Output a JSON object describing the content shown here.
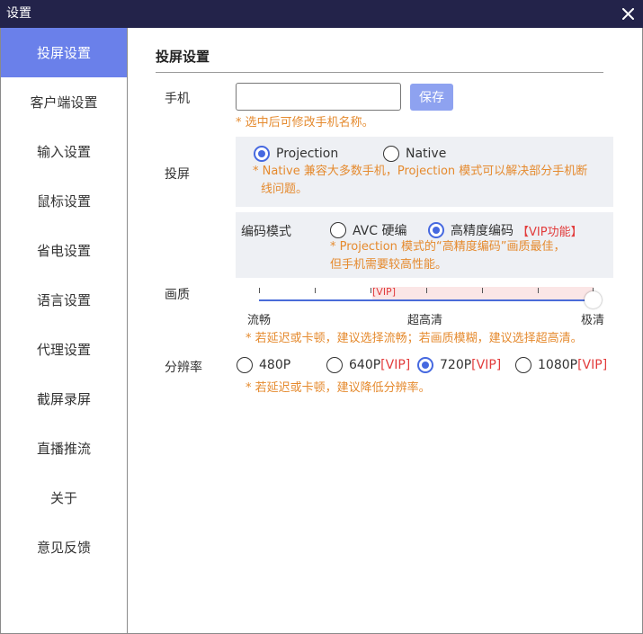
{
  "window": {
    "title": "设置"
  },
  "sidebar": {
    "items": [
      {
        "label": "投屏设置",
        "active": true
      },
      {
        "label": "客户端设置"
      },
      {
        "label": "输入设置"
      },
      {
        "label": "鼠标设置"
      },
      {
        "label": "省电设置"
      },
      {
        "label": "语言设置"
      },
      {
        "label": "代理设置"
      },
      {
        "label": "截屏录屏"
      },
      {
        "label": "直播推流"
      },
      {
        "label": "关于"
      },
      {
        "label": "意见反馈"
      }
    ]
  },
  "main": {
    "title": "投屏设置",
    "phone": {
      "label": "手机",
      "value": "",
      "save_label": "保存",
      "note": "* 选中后可修改手机名称。"
    },
    "projection": {
      "label": "投屏",
      "options": [
        {
          "label": "Projection",
          "selected": true
        },
        {
          "label": "Native",
          "selected": false
        }
      ],
      "note_line1": "* Native 兼容大多数手机，Projection 模式可以解决部分手机断",
      "note_line2": "线问题。"
    },
    "encoding": {
      "label": "编码模式",
      "options": [
        {
          "label": "AVC 硬编",
          "selected": false
        },
        {
          "label": "高精度编码",
          "selected": true,
          "tag": "【VIP功能】"
        }
      ],
      "note_line1": "* Projection 模式的“高精度编码”画质最佳，",
      "note_line2": "但手机需要较高性能。"
    },
    "quality": {
      "label": "画质",
      "vip_tag": "[VIP]",
      "marks": [
        "流畅",
        "超高清",
        "极清"
      ],
      "value_fraction": 1.0,
      "note": "* 若延迟或卡顿，建议选择流畅；若画质模糊，建议选择超高清。"
    },
    "resolution": {
      "label": "分辨率",
      "options": [
        {
          "label": "480P",
          "tag": "",
          "selected": false
        },
        {
          "label": "640P",
          "tag": "[VIP]",
          "selected": false
        },
        {
          "label": "720P",
          "tag": "[VIP]",
          "selected": true
        },
        {
          "label": "1080P",
          "tag": "[VIP]",
          "selected": false
        }
      ],
      "note": "* 若延迟或卡顿，建议降低分辨率。"
    }
  },
  "colors": {
    "titlebar": "#23234a",
    "accent": "#6a80ea",
    "radio": "#4669e0",
    "note": "#e58a2e",
    "vip": "#e23c3c",
    "button": "#8ea2f0"
  },
  "icons": {
    "close": "close-icon"
  }
}
